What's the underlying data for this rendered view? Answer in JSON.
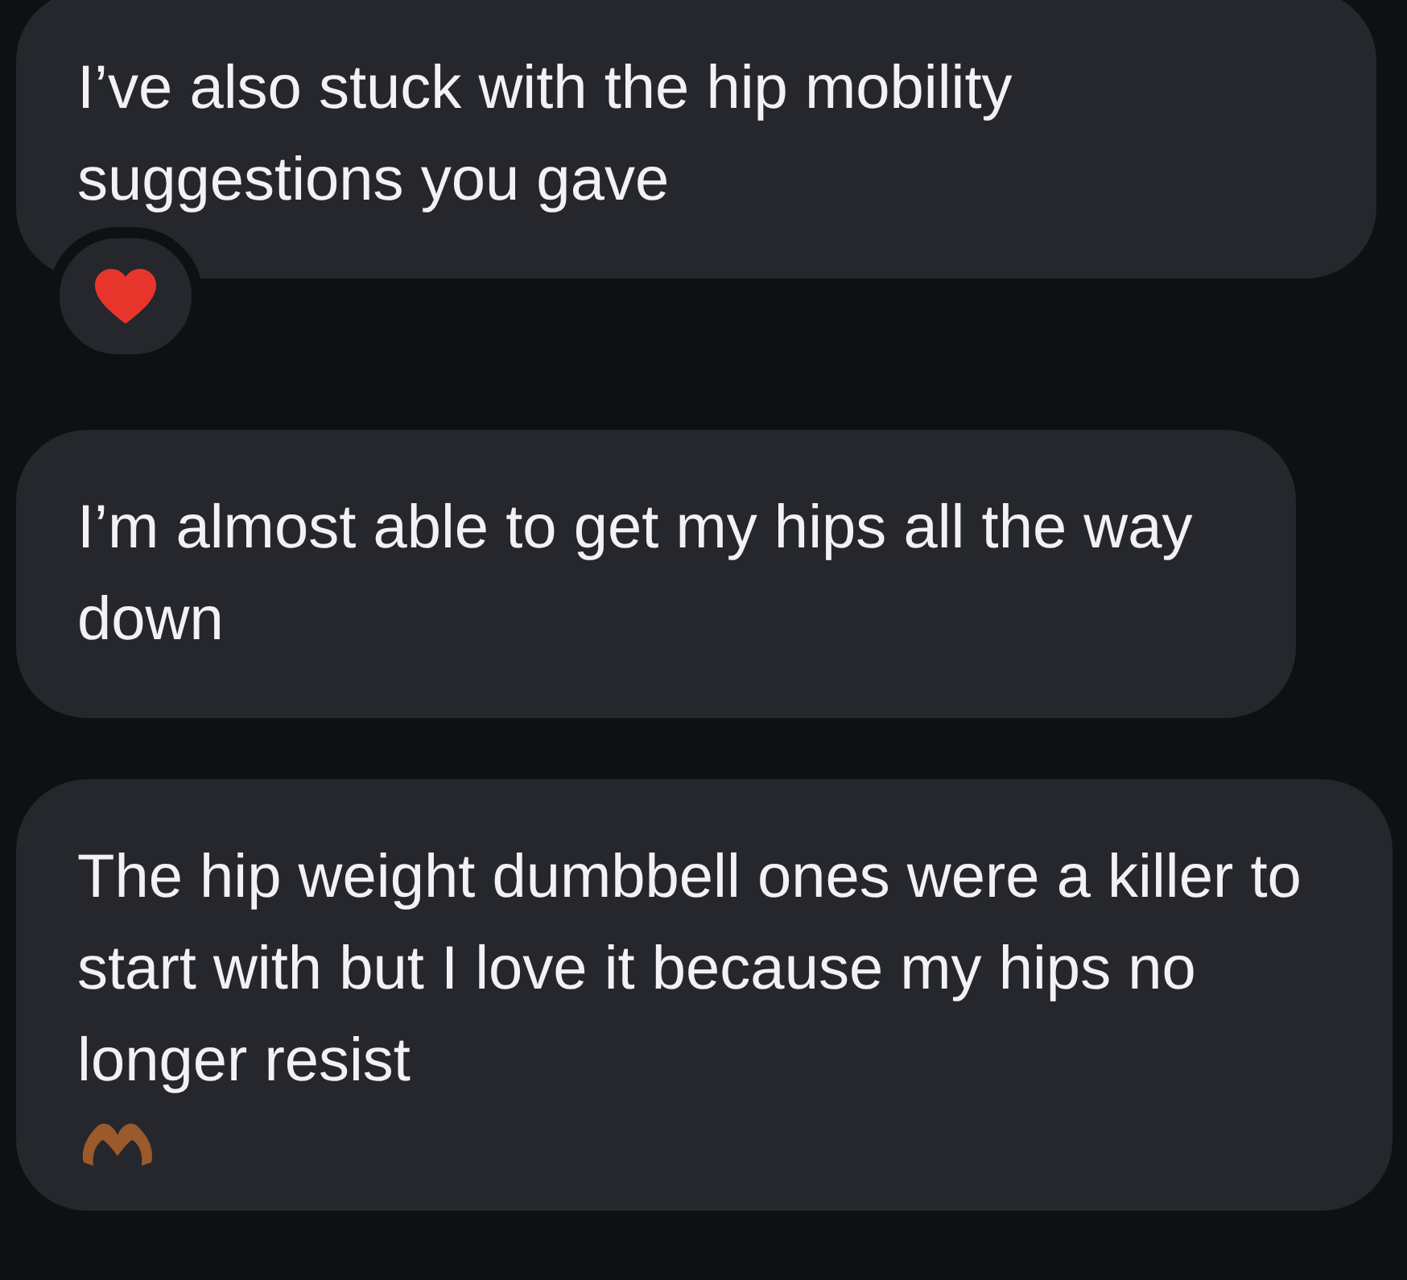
{
  "messages": [
    {
      "text": "I’ve also stuck with the hip mobility suggestions you gave",
      "reaction": {
        "kind": "heart"
      }
    },
    {
      "text": "I’m almost able to get my hips all the way down"
    },
    {
      "text": "The hip weight dumbbell ones were a killer to start with but I love it because my hips no longer resist",
      "trailing_icon": {
        "kind": "heart-hands"
      }
    }
  ]
}
